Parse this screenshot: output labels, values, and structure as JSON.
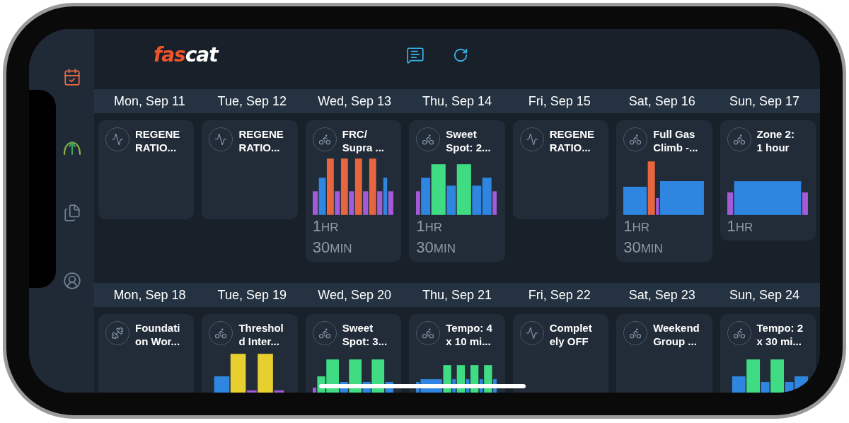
{
  "sidebar": {
    "items": [
      {
        "kind": "calendar",
        "selected": true
      },
      {
        "kind": "progress",
        "selected": false
      },
      {
        "kind": "documents",
        "selected": false
      },
      {
        "kind": "profile",
        "selected": false
      }
    ]
  },
  "header": {
    "logo": {
      "accent": "fas",
      "rest": "cat"
    }
  },
  "weeks": [
    {
      "days": [
        {
          "label": "Mon, Sep 11",
          "kind": "rest",
          "title_lines": [
            "REGENE",
            "RATIO..."
          ],
          "profile": false
        },
        {
          "label": "Tue, Sep 12",
          "kind": "rest",
          "title_lines": [
            "REGENE",
            "RATIO..."
          ],
          "profile": false
        },
        {
          "label": "Wed, Sep 13",
          "kind": "ride",
          "title_lines": [
            "FRC/",
            "Supra ..."
          ],
          "profile": true,
          "duration": [
            {
              "value": "1",
              "unit": "HR"
            },
            {
              "value": "30",
              "unit": "MIN"
            }
          ]
        },
        {
          "label": "Thu, Sep 14",
          "kind": "ride",
          "title_lines": [
            "Sweet",
            "Spot: 2..."
          ],
          "profile": true,
          "duration": [
            {
              "value": "1",
              "unit": "HR"
            },
            {
              "value": "30",
              "unit": "MIN"
            }
          ]
        },
        {
          "label": "Fri, Sep 15",
          "kind": "rest",
          "title_lines": [
            "REGENE",
            "RATIO..."
          ],
          "profile": false
        },
        {
          "label": "Sat, Sep 16",
          "kind": "ride",
          "title_lines": [
            "Full Gas",
            "Climb -..."
          ],
          "profile": true,
          "duration": [
            {
              "value": "1",
              "unit": "HR"
            },
            {
              "value": "30",
              "unit": "MIN"
            }
          ]
        },
        {
          "label": "Sun, Sep 17",
          "kind": "ride",
          "title_lines": [
            "Zone 2:",
            "1 hour"
          ],
          "profile": true,
          "duration": [
            {
              "value": "1",
              "unit": "HR"
            }
          ]
        }
      ]
    },
    {
      "days": [
        {
          "label": "Mon, Sep 18",
          "kind": "strength",
          "title_lines": [
            "Foundati",
            "on Wor..."
          ],
          "profile": false
        },
        {
          "label": "Tue, Sep 19",
          "kind": "ride",
          "title_lines": [
            "Threshol",
            "d Inter..."
          ],
          "profile": true
        },
        {
          "label": "Wed, Sep 20",
          "kind": "ride",
          "title_lines": [
            "Sweet",
            "Spot: 3..."
          ],
          "profile": true
        },
        {
          "label": "Thu, Sep 21",
          "kind": "ride",
          "title_lines": [
            "Tempo: 4",
            "x 10 mi..."
          ],
          "profile": true
        },
        {
          "label": "Fri, Sep 22",
          "kind": "rest",
          "title_lines": [
            "Complet",
            "ely OFF"
          ],
          "profile": false
        },
        {
          "label": "Sat, Sep 23",
          "kind": "ride",
          "title_lines": [
            "Weekend",
            "Group ..."
          ],
          "profile": false
        },
        {
          "label": "Sun, Sep 24",
          "kind": "ride",
          "title_lines": [
            "Tempo: 2",
            "x 30 mi..."
          ],
          "profile": true
        }
      ]
    }
  ]
}
